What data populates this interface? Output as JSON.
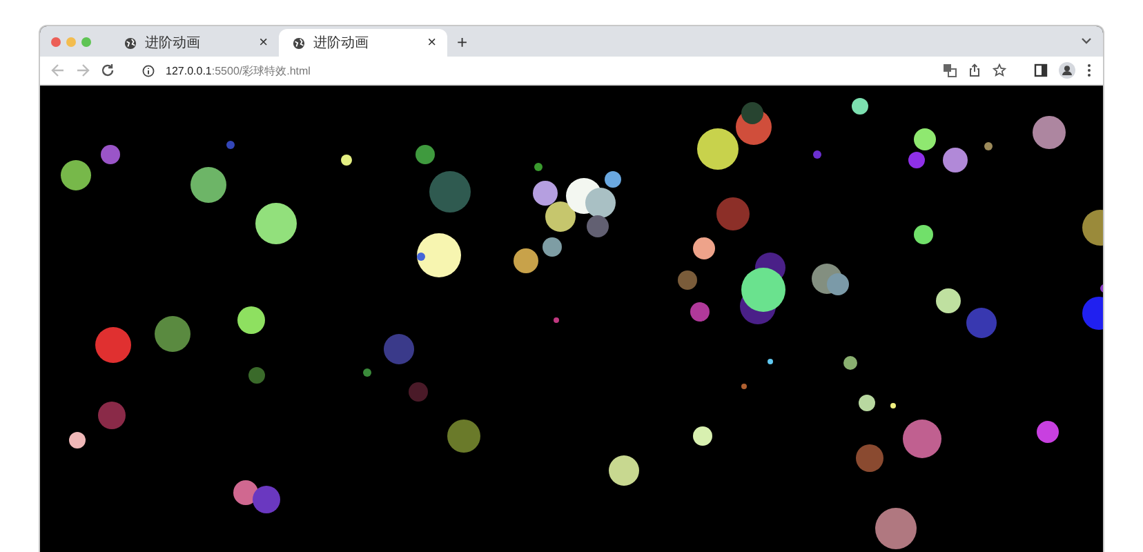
{
  "tabs": [
    {
      "title": "进阶动画",
      "close": "×",
      "selected": false
    },
    {
      "title": "进阶动画",
      "close": "×",
      "selected": true
    }
  ],
  "new_tab": "+",
  "address": {
    "url": "**127.0.0.1**:5500/彩球特效.html"
  }
}
